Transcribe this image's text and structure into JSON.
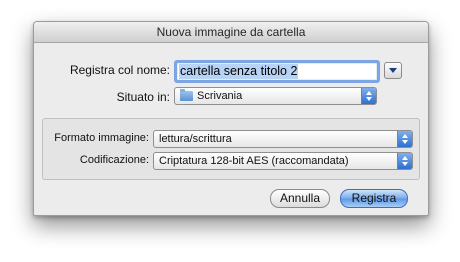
{
  "window": {
    "title": "Nuova immagine da cartella"
  },
  "form": {
    "name_label": "Registra col nome:",
    "name_value": "cartella senza titolo 2",
    "location_label": "Situato in:",
    "location_value": "Scrivania",
    "location_icon": "folder-icon"
  },
  "options": {
    "format_label": "Formato immagine:",
    "format_value": "lettura/scrittura",
    "encryption_label": "Codificazione:",
    "encryption_value": "Criptatura 128-bit AES (raccomandata)"
  },
  "buttons": {
    "cancel_label": "Annulla",
    "save_label": "Registra"
  },
  "colors": {
    "accent": "#5d97e3",
    "focus_ring": "#7ba6e3",
    "selection": "#b7d3f5"
  }
}
